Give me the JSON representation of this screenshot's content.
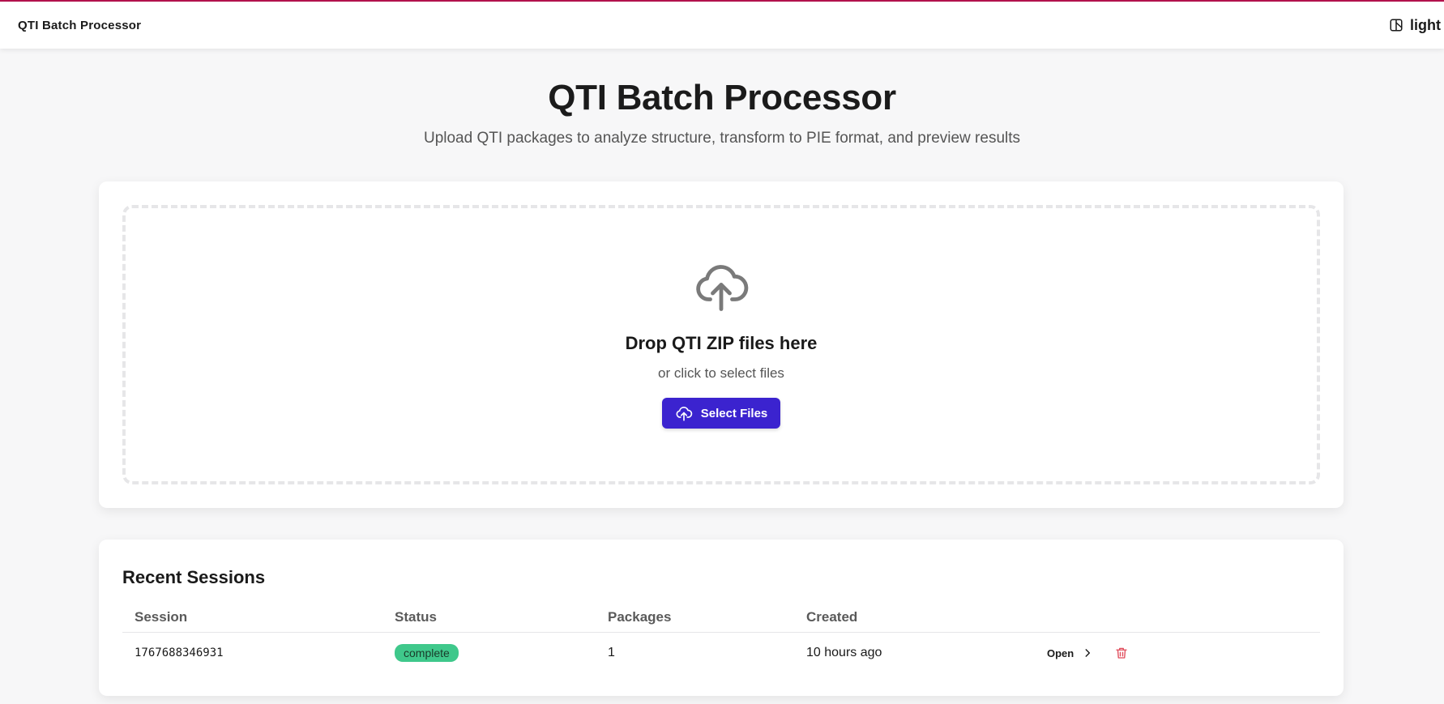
{
  "navbar": {
    "brand": "QTI Batch Processor",
    "theme_label": "light"
  },
  "hero": {
    "title": "QTI Batch Processor",
    "subtitle": "Upload QTI packages to analyze structure, transform to PIE format, and preview results"
  },
  "upload": {
    "title": "Drop QTI ZIP files here",
    "subtitle": "or click to select files",
    "button_label": "Select Files"
  },
  "sessions": {
    "title": "Recent Sessions",
    "columns": [
      "Session",
      "Status",
      "Packages",
      "Created"
    ],
    "rows": [
      {
        "session": "1767688346931",
        "status": "complete",
        "packages": "1",
        "created": "10 hours ago",
        "open_label": "Open"
      }
    ]
  },
  "colors": {
    "accent": "#b5134d",
    "primary_button": "#3b23cf",
    "status_complete": "#3fc88b",
    "delete": "#e04b5a"
  },
  "icons": {
    "theme": "theme-icon",
    "upload": "cloud-upload-icon",
    "open": "chevron-right-icon",
    "delete": "trash-icon"
  }
}
